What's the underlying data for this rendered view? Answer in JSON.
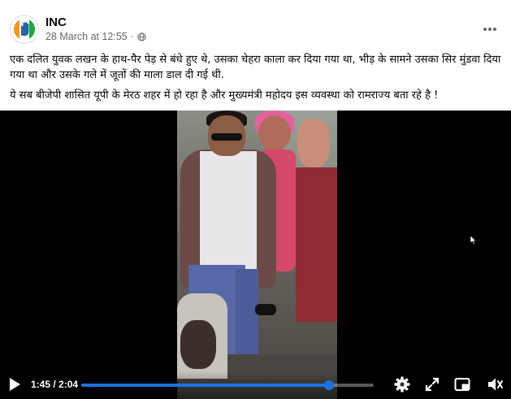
{
  "post": {
    "page_name": "INC",
    "date": "28 March at 12:55",
    "separator": "·",
    "text_paragraph_1": "एक दलित युवक लखन के हाथ-पैर पेड़ से बंधे हुए थे, उसका चेहरा काला कर दिया गया था, भीड़ के सामने उसका सिर मुंडवा दिया गया था और उसके गले में जूतों की माला डाल दी गई थी.",
    "text_paragraph_2": "ये सब बीजेपी शासित यूपी के मेरठ शहर में हो रहा है और मुख्यमंत्री महोदय इस व्यवस्था को रामराज्य बता रहे है !"
  },
  "icons": {
    "avatar": "congress-hand-logo",
    "privacy": "globe-icon",
    "more": "more-options-icon",
    "play": "play-icon",
    "settings": "gear-icon",
    "fullscreen": "expand-icon",
    "pip": "picture-in-picture-icon",
    "volume": "volume-icon",
    "cursor": "mouse-cursor-icon"
  },
  "video": {
    "current_time": "1:45",
    "duration": "2:04",
    "time_display": "1:45 / 2:04",
    "progress_fraction": 0.847
  },
  "colors": {
    "accent": "#1b74e4",
    "secondary_text": "#65676b"
  }
}
